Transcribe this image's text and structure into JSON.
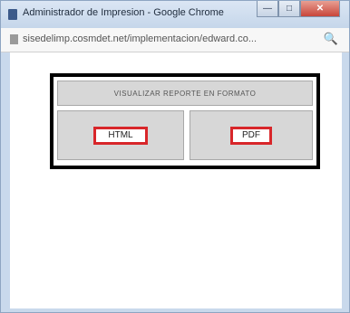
{
  "window": {
    "title": "Administrador de Impresion - Google Chrome",
    "minimize_label": "—",
    "maximize_label": "□",
    "close_label": "✕"
  },
  "addressbar": {
    "url": "sisedelimp.cosmdet.net/implementacion/edward.co..."
  },
  "panel": {
    "header": "VISUALIZAR REPORTE EN FORMATO",
    "html_label": "HTML",
    "pdf_label": "PDF"
  },
  "colors": {
    "highlight": "#d8262a",
    "cell_bg": "#d7d7d7",
    "frame": "#000000"
  }
}
